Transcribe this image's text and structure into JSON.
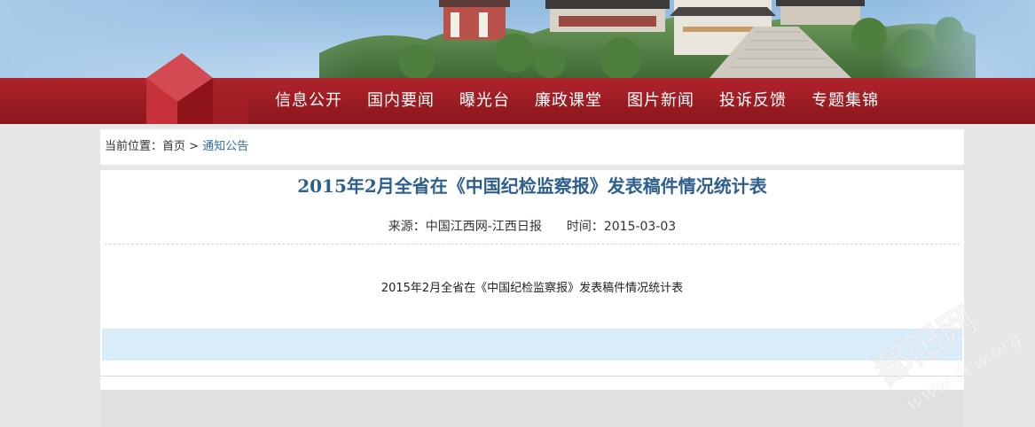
{
  "nav": {
    "items": [
      {
        "label": "信息公开"
      },
      {
        "label": "国内要闻"
      },
      {
        "label": "曝光台"
      },
      {
        "label": "廉政课堂"
      },
      {
        "label": "图片新闻"
      },
      {
        "label": "投诉反馈"
      },
      {
        "label": "专题集锦"
      }
    ]
  },
  "breadcrumb": {
    "prefix": "当前位置：",
    "home": "首页",
    "separator": " > ",
    "current": "通知公告"
  },
  "article": {
    "title": "2015年2月全省在《中国纪检监察报》发表稿件情况统计表",
    "source_label": "来源：",
    "source": "中国江西网-江西日报",
    "time_label": "时间：",
    "time": "2015-03-03",
    "body": "2015年2月全省在《中国纪检监察报》发表稿件情况统计表"
  },
  "watermark": {
    "logo_text": "鄱阳网",
    "url_text": "www.dcw.org"
  },
  "colors": {
    "nav_red": "#9a1c22",
    "title_blue": "#2d5f8d",
    "link_blue": "#2f6ea8",
    "band_blue": "#d8ecf9",
    "page_bg": "#e8e7e8"
  }
}
